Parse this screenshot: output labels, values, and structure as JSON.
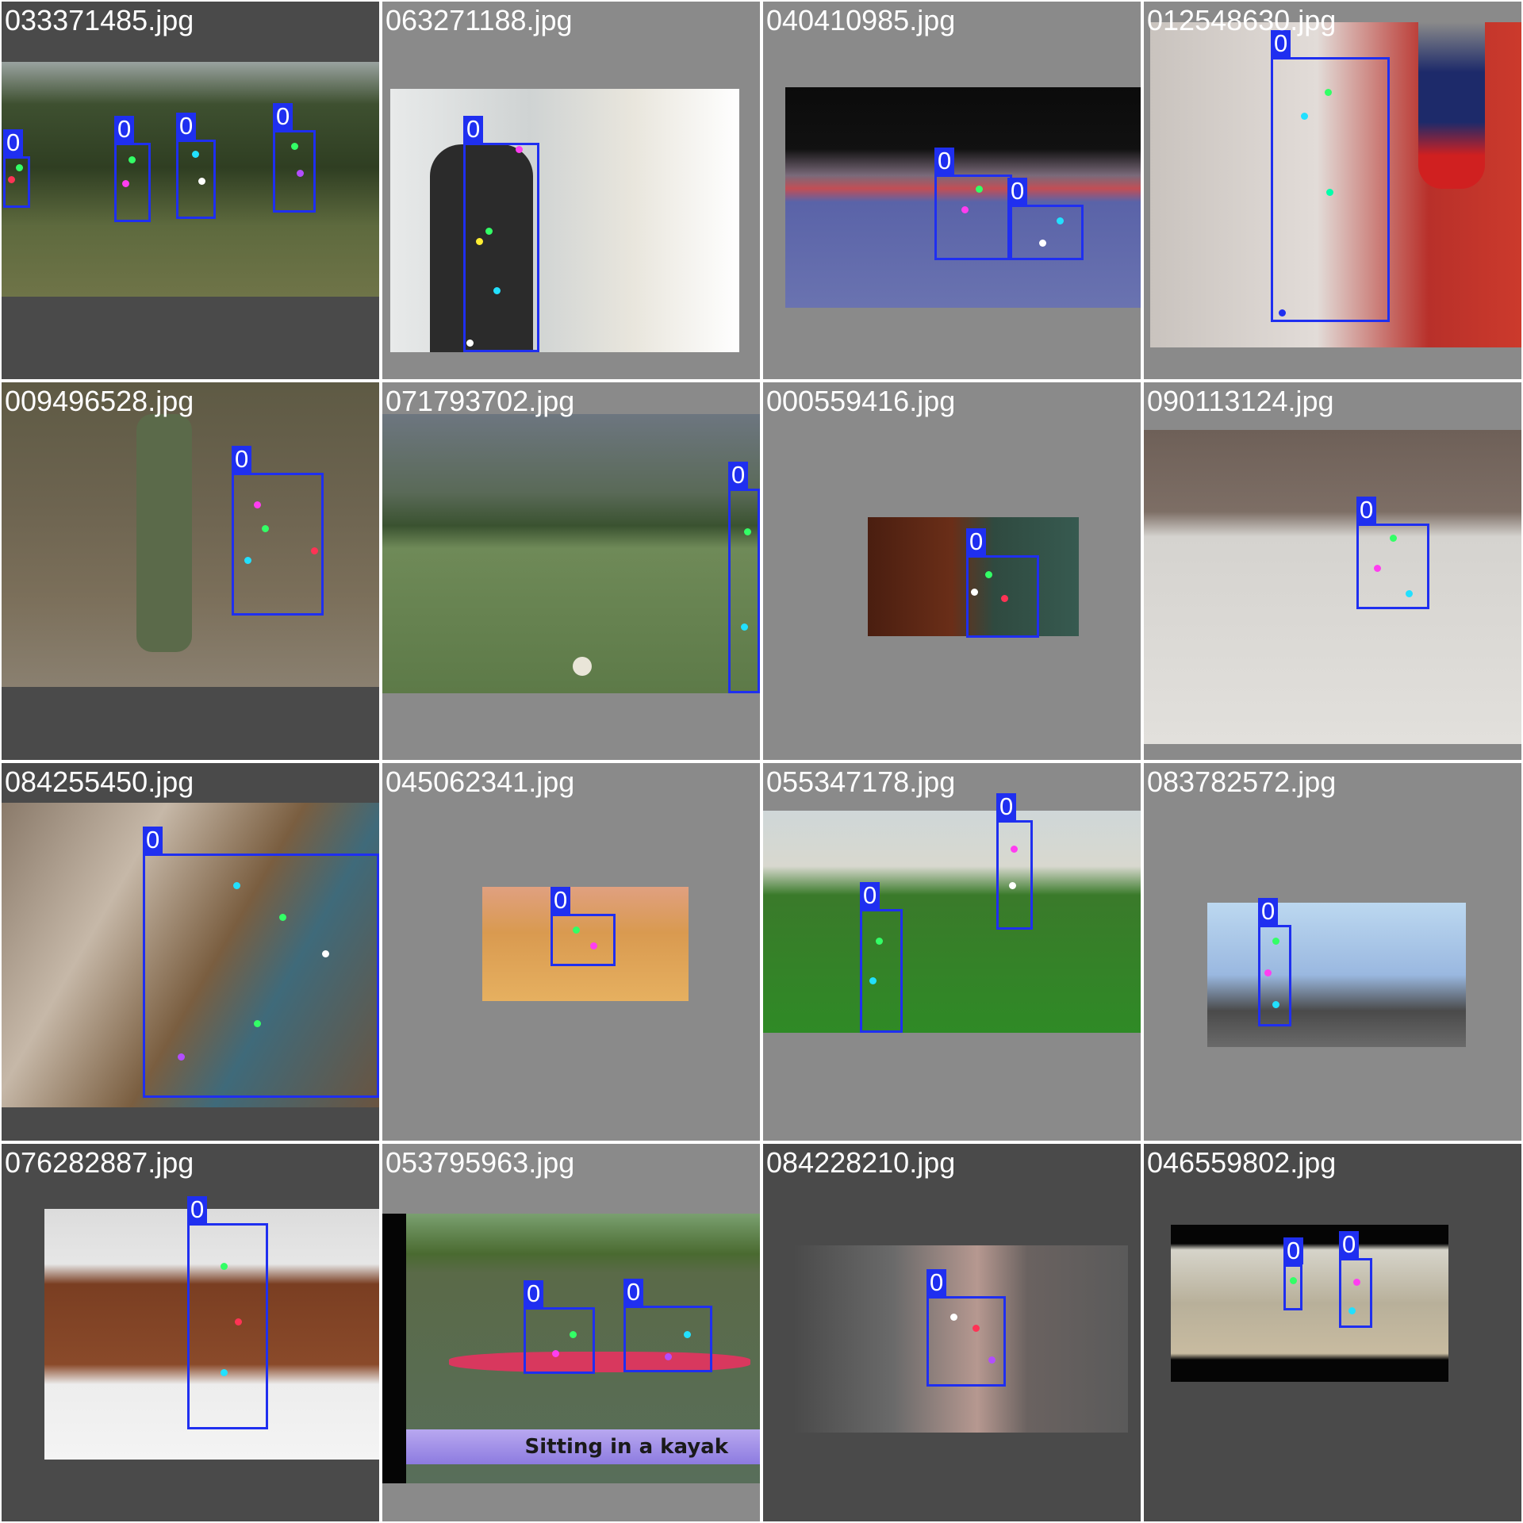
{
  "grid": {
    "tiles": [
      {
        "filename": "033371485.jpg",
        "label_count": 4,
        "class_label": "0"
      },
      {
        "filename": "063271188.jpg",
        "label_count": 1,
        "class_label": "0"
      },
      {
        "filename": "040410985.jpg",
        "label_count": 2,
        "class_label": "0"
      },
      {
        "filename": "012548630.jpg",
        "label_count": 1,
        "class_label": "0"
      },
      {
        "filename": "009496528.jpg",
        "label_count": 1,
        "class_label": "0"
      },
      {
        "filename": "071793702.jpg",
        "label_count": 1,
        "class_label": "0"
      },
      {
        "filename": "000559416.jpg",
        "label_count": 1,
        "class_label": "0"
      },
      {
        "filename": "090113124.jpg",
        "label_count": 1,
        "class_label": "0"
      },
      {
        "filename": "084255450.jpg",
        "label_count": 1,
        "class_label": "0"
      },
      {
        "filename": "045062341.jpg",
        "label_count": 1,
        "class_label": "0"
      },
      {
        "filename": "055347178.jpg",
        "label_count": 2,
        "class_label": "0"
      },
      {
        "filename": "083782572.jpg",
        "label_count": 1,
        "class_label": "0"
      },
      {
        "filename": "076282887.jpg",
        "label_count": 1,
        "class_label": "0"
      },
      {
        "filename": "053795963.jpg",
        "label_count": 2,
        "class_label": "0",
        "caption": "Sitting in a kayak"
      },
      {
        "filename": "084228210.jpg",
        "label_count": 1,
        "class_label": "0"
      },
      {
        "filename": "046559802.jpg",
        "label_count": 2,
        "class_label": "0"
      }
    ]
  },
  "colors": {
    "box": "#1f2ff0",
    "keypoints": [
      "#ff3df0",
      "#33ff66",
      "#22e0ff",
      "#ffffff",
      "#ff3355",
      "#b24dff",
      "#00ffaa"
    ]
  }
}
